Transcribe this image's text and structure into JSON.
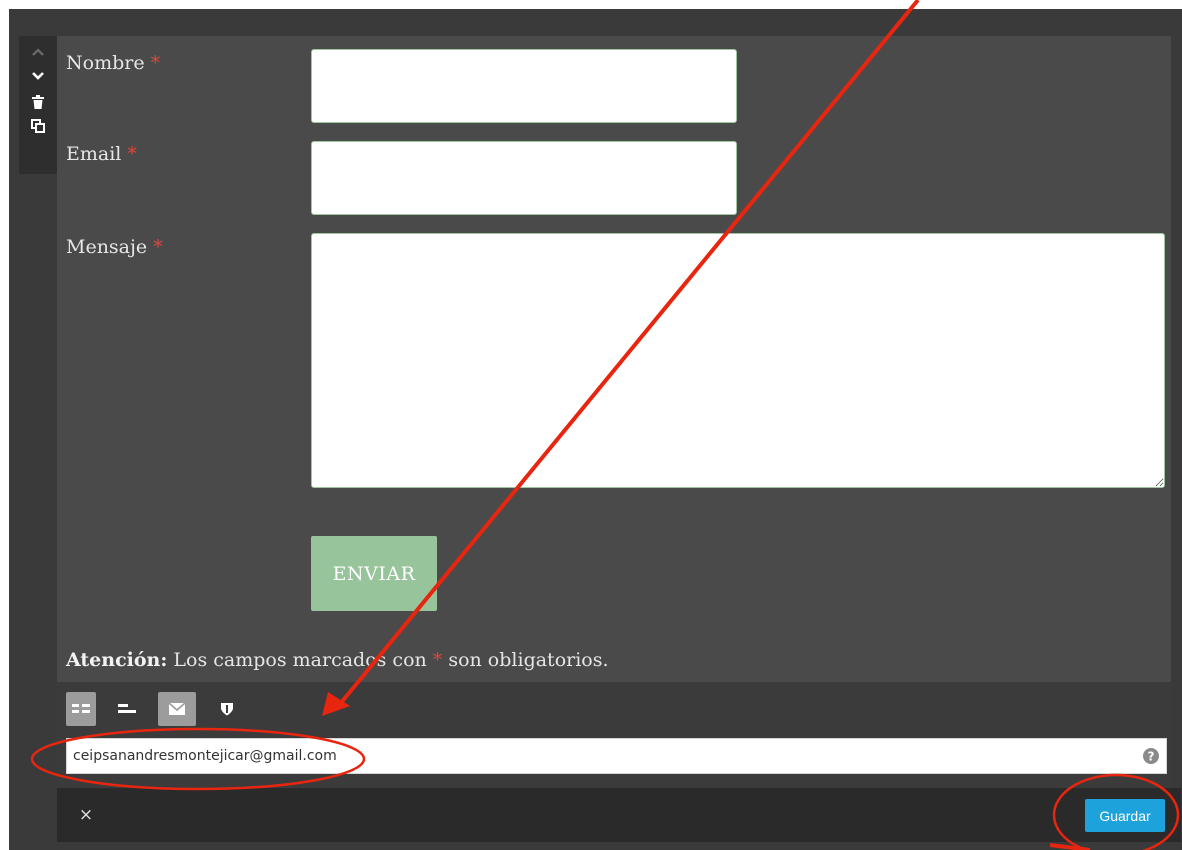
{
  "form": {
    "fields": [
      {
        "label": "Nombre",
        "required_mark": "*",
        "value": ""
      },
      {
        "label": "Email",
        "required_mark": "*",
        "value": ""
      },
      {
        "label": "Mensaje",
        "required_mark": "*",
        "value": ""
      }
    ],
    "submit_label": "ENVIAR",
    "note": {
      "strong": "Atención:",
      "text_before": "Los campos marcados con",
      "mark": "*",
      "text_after": "son obligatorios."
    }
  },
  "settings": {
    "recipient_email": "ceipsanandresmontejicar@gmail.com"
  },
  "footer": {
    "close_label": "×",
    "save_label": "Guardar"
  },
  "colors": {
    "accent": "#1ea2dc",
    "submit": "#98c49b",
    "required": "#e0473a",
    "annotation": "#e8260f"
  },
  "icons": {
    "toolbox": [
      "chevron-up-icon",
      "chevron-down-icon",
      "trash-icon",
      "duplicate-icon"
    ],
    "options": [
      "layout-two-columns-icon",
      "layout-one-column-icon",
      "envelope-icon",
      "shield-icon"
    ],
    "help": "question-circle-icon"
  }
}
